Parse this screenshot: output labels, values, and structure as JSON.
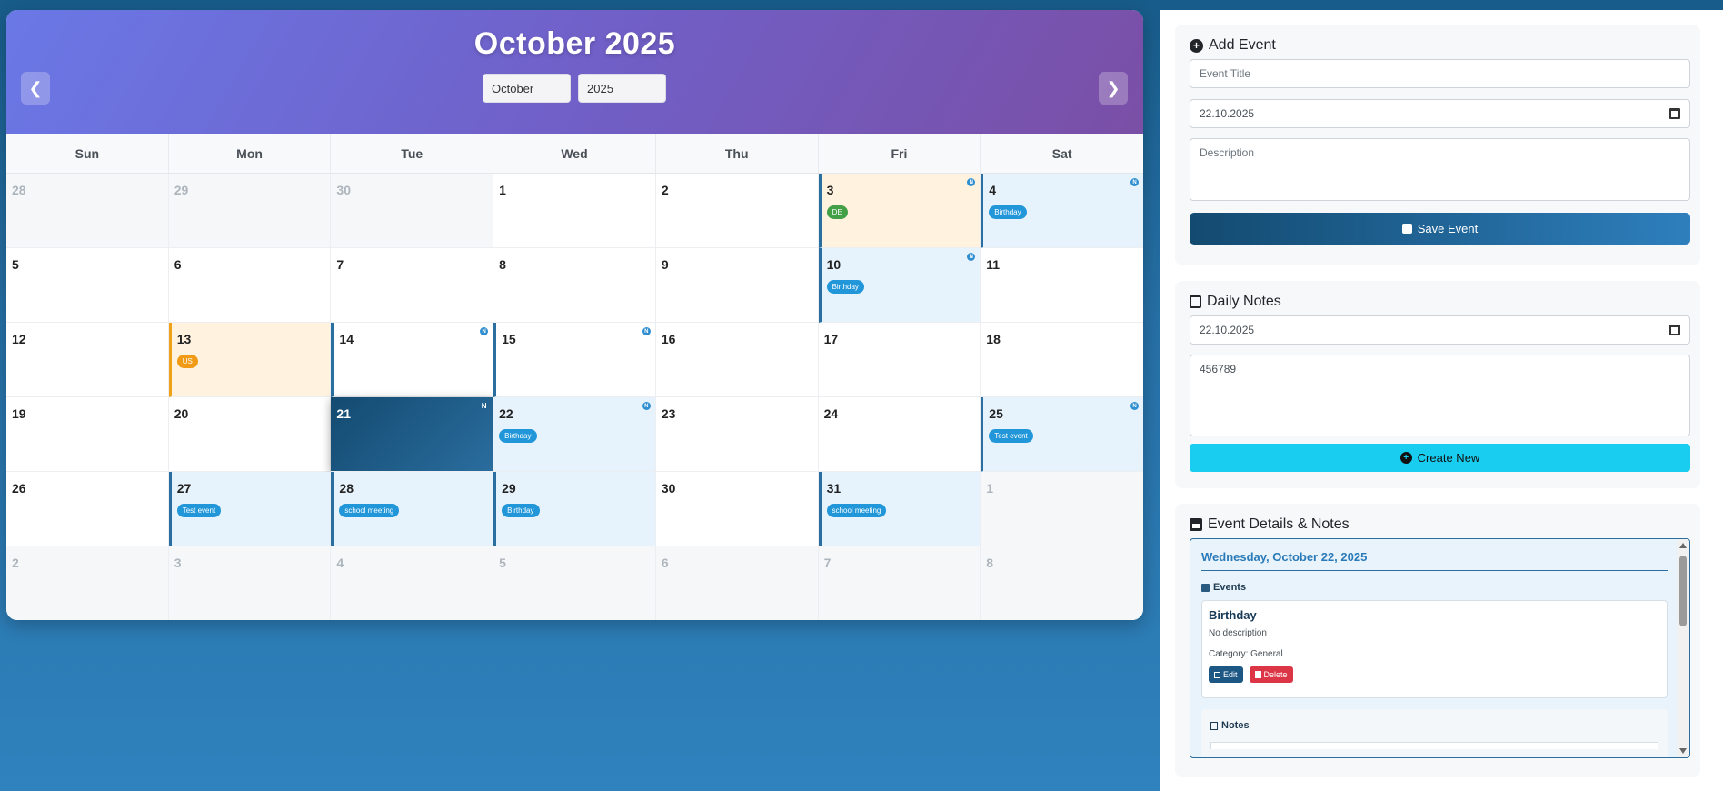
{
  "calendar": {
    "title": "October 2025",
    "month_select": "October",
    "year_select": "2025",
    "weekdays": [
      "Sun",
      "Mon",
      "Tue",
      "Wed",
      "Thu",
      "Fri",
      "Sat"
    ],
    "days": [
      {
        "n": "28",
        "t": "other"
      },
      {
        "n": "29",
        "t": "other"
      },
      {
        "n": "30",
        "t": "other"
      },
      {
        "n": "1"
      },
      {
        "n": "2"
      },
      {
        "n": "3",
        "t": "holiday",
        "lb": "blue",
        "badge": "DE",
        "bc": "green",
        "note": true
      },
      {
        "n": "4",
        "t": "event",
        "lb": "blue",
        "badge": "Birthday",
        "note": true
      },
      {
        "n": "5"
      },
      {
        "n": "6"
      },
      {
        "n": "7"
      },
      {
        "n": "8"
      },
      {
        "n": "9"
      },
      {
        "n": "10",
        "t": "event",
        "lb": "blue",
        "badge": "Birthday",
        "note": true
      },
      {
        "n": "11"
      },
      {
        "n": "12"
      },
      {
        "n": "13",
        "t": "holiday",
        "lb": "orange",
        "badge": "US",
        "bc": "orange"
      },
      {
        "n": "14",
        "lb": "blue",
        "note": true
      },
      {
        "n": "15",
        "lb": "blue",
        "note": true
      },
      {
        "n": "16"
      },
      {
        "n": "17"
      },
      {
        "n": "18"
      },
      {
        "n": "19"
      },
      {
        "n": "20"
      },
      {
        "n": "21",
        "t": "today",
        "note": true
      },
      {
        "n": "22",
        "t": "event",
        "badge": "Birthday",
        "note": true
      },
      {
        "n": "23"
      },
      {
        "n": "24"
      },
      {
        "n": "25",
        "t": "event",
        "lb": "blue",
        "badge": "Test event",
        "note": true
      },
      {
        "n": "26"
      },
      {
        "n": "27",
        "t": "event",
        "lb": "blue",
        "badge": "Test event"
      },
      {
        "n": "28",
        "t": "event",
        "lb": "blue",
        "badge": "school meeting"
      },
      {
        "n": "29",
        "t": "event",
        "lb": "blue",
        "badge": "Birthday"
      },
      {
        "n": "30"
      },
      {
        "n": "31",
        "t": "event",
        "lb": "blue",
        "badge": "school meeting"
      },
      {
        "n": "1",
        "t": "other"
      },
      {
        "n": "2",
        "t": "other"
      },
      {
        "n": "3",
        "t": "other"
      },
      {
        "n": "4",
        "t": "other"
      },
      {
        "n": "5",
        "t": "other"
      },
      {
        "n": "6",
        "t": "other"
      },
      {
        "n": "7",
        "t": "other"
      },
      {
        "n": "8",
        "t": "other"
      }
    ],
    "note_marker": "N"
  },
  "add_event": {
    "title": "Add Event",
    "title_placeholder": "Event Title",
    "date_value": "22.10.2025",
    "description_placeholder": "Description",
    "save_label": "Save Event"
  },
  "daily_notes": {
    "title": "Daily Notes",
    "date_value": "22.10.2025",
    "note_value": "456789",
    "create_label": "Create New"
  },
  "details": {
    "title": "Event Details & Notes",
    "date_heading": "Wednesday, October 22, 2025",
    "events_label": "Events",
    "event_title": "Birthday",
    "event_description": "No description",
    "event_category": "Category: General",
    "edit_label": "Edit",
    "delete_label": "Delete",
    "notes_label": "Notes"
  },
  "colors": {
    "accent": "#2a6d9e",
    "header_gradient_start": "#6a78e6",
    "header_gradient_end": "#7a4fa6",
    "event_badge": "#2196d9",
    "holiday_de": "#43a047",
    "holiday_us": "#f09a16",
    "create_button": "#19cdf0",
    "delete_button": "#dc3545"
  }
}
